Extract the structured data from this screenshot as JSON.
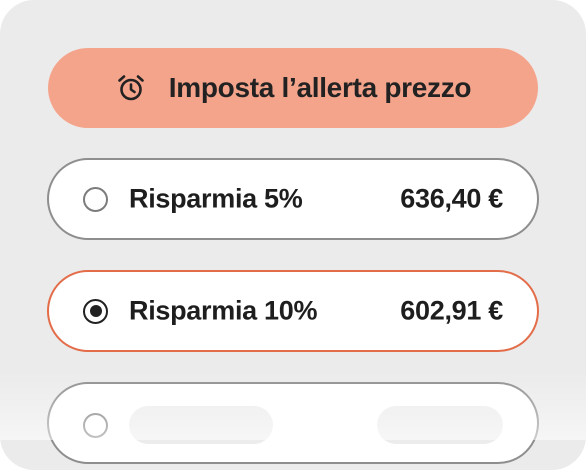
{
  "colors": {
    "panel_background": "#ebebeb",
    "cta_background": "#f5a48c",
    "selected_border": "#e36c49",
    "unselected_border": "#8e8e8e",
    "text": "#1e1e1e"
  },
  "price_alert": {
    "label": "Imposta l’allerta prezzo",
    "icon": "alarm-clock-icon"
  },
  "options": [
    {
      "label": "Risparmia 5%",
      "price": "636,40 €",
      "selected": false
    },
    {
      "label": "Risparmia 10%",
      "price": "602,91 €",
      "selected": true
    },
    {
      "label": "",
      "price": "",
      "selected": false,
      "loading": true
    }
  ]
}
